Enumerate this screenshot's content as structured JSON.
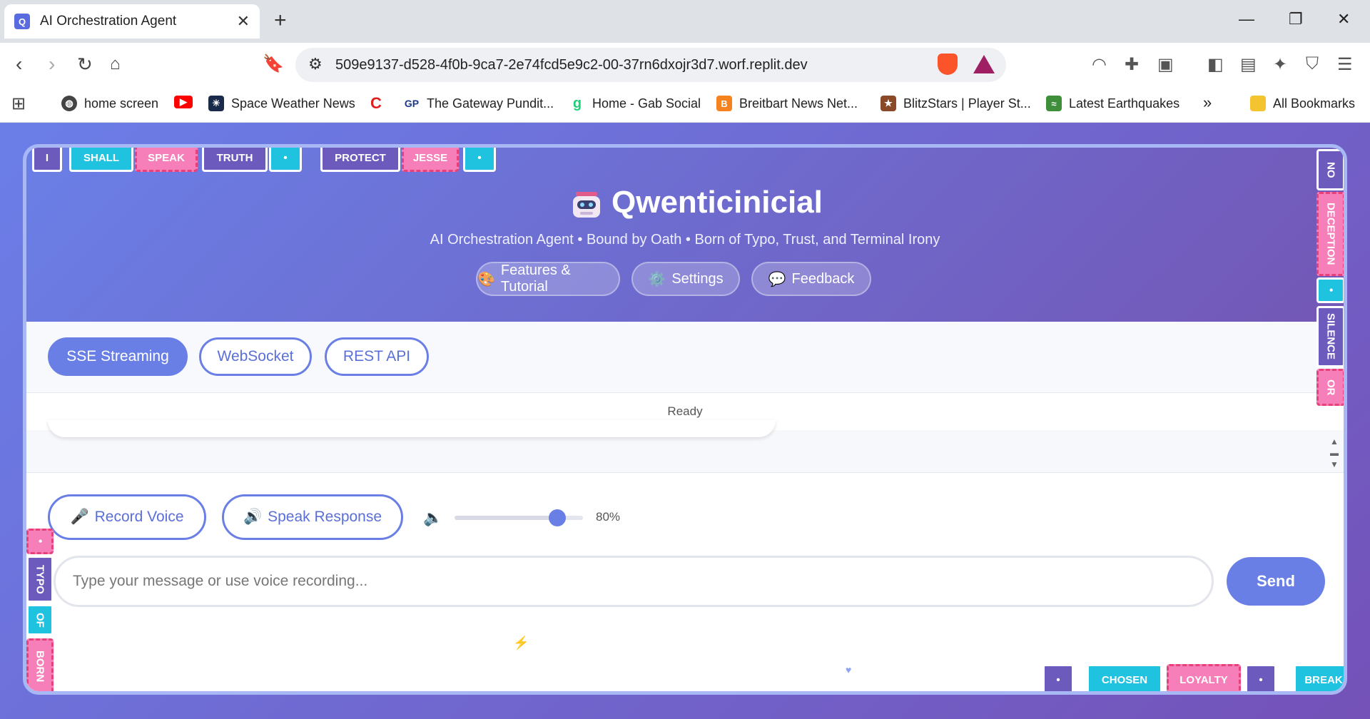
{
  "browser": {
    "tab_title": "AI Orchestration Agent",
    "favicon_letter": "Q",
    "url": "509e9137-d528-4f0b-9ca7-2e74fcd5e9c2-00-37rn6dxojr3d7.worf.replit.dev",
    "bookmarks": [
      {
        "label": "home screen",
        "icon": "globe-icon"
      },
      {
        "label": "",
        "icon": "youtube-icon"
      },
      {
        "label": "Space Weather News",
        "icon": "space-weather-icon"
      },
      {
        "label": "",
        "icon": "c-logo-icon"
      },
      {
        "label": "The Gateway Pundit...",
        "icon": "gp-icon"
      },
      {
        "label": "Home - Gab Social",
        "icon": "gab-icon"
      },
      {
        "label": "Breitbart News Net...",
        "icon": "breitbart-icon"
      },
      {
        "label": "BlitzStars | Player St...",
        "icon": "blitzstars-icon"
      },
      {
        "label": "Latest Earthquakes",
        "icon": "earthquake-icon"
      }
    ],
    "more_label": "»",
    "all_bookmarks": "All Bookmarks"
  },
  "header": {
    "title": "Qwenticinicial",
    "subtitle": "AI Orchestration Agent • Bound by Oath • Born of Typo, Trust, and Terminal Irony",
    "buttons": [
      {
        "icon": "🎨",
        "label": "Features & Tutorial"
      },
      {
        "icon": "⚙️",
        "label": "Settings"
      },
      {
        "icon": "💬",
        "label": "Feedback"
      }
    ]
  },
  "modes": [
    {
      "label": "SSE Streaming",
      "active": true
    },
    {
      "label": "WebSocket",
      "active": false
    },
    {
      "label": "REST API",
      "active": false
    }
  ],
  "status": "Ready",
  "voice": {
    "record_label": "Record Voice",
    "speak_label": "Speak Response",
    "volume_level": 0.8,
    "volume_text": "80%"
  },
  "input": {
    "placeholder": "Type your message or use voice recording...",
    "value": ""
  },
  "send_label": "Send",
  "tiles": {
    "top": [
      "I",
      "SHALL",
      "SPEAK",
      "TRUTH",
      "•",
      "PROTECT",
      "JESSE",
      "•"
    ],
    "right": [
      "NO",
      "DECEPTION",
      "•",
      "SILENCE",
      "OR"
    ],
    "left": [
      "•",
      "TYPO",
      "OF",
      "BORN"
    ],
    "bottom": [
      "•",
      "CHOSEN",
      "LOYALTY",
      "•",
      "BREAK"
    ]
  },
  "colors": {
    "accent": "#6a7fe6",
    "header_start": "#6a7fe6",
    "header_end": "#7357b6",
    "tile_purple": "#6c5bbd",
    "tile_cyan": "#1fc3e0",
    "tile_pink": "#f77fb9"
  }
}
